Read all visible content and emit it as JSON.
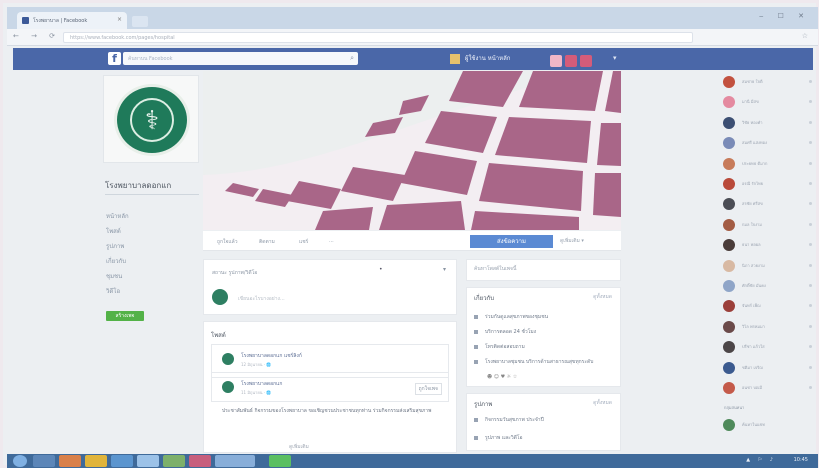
{
  "browser": {
    "tab_title": "โรงพยาบาล | Facebook",
    "tab_close": "×",
    "window_controls": "‒ ☐ ✕",
    "nav_buttons": "← → ⟳",
    "url": "https://www.facebook.com/pages/hospital",
    "bookmark_star": "☆"
  },
  "fb": {
    "logo": "f",
    "search_placeholder": "ค้นหาบน Facebook",
    "search_icon": "⌕",
    "user_label": "ผู้ใช้งาน   หน้าหลัก",
    "menu_glyph": "▾"
  },
  "page": {
    "name": "โรงพยาบาลดอกแก",
    "logo_symbol": "⚕",
    "nav": [
      "หน้าหลัก",
      "โพสต์",
      "รูปภาพ",
      "เกี่ยวกับ",
      "ชุมชน",
      "วิดีโอ"
    ],
    "green_button": "สร้างเพจ",
    "tabs": [
      "ถูกใจแล้ว",
      "ติดตาม",
      "แชร์",
      "..."
    ],
    "like_button": "ส่งข้อความ",
    "more_button": "ดูเพิ่มเติม ▾",
    "composer_tab": "สถานะ   รูปภาพ/วิดีโอ",
    "composer_dot": "•",
    "composer_caret": "▾",
    "composer_placeholder": "เขียนอะไรบางอย่าง...",
    "feed_heading": "โพสต์",
    "posts": [
      {
        "name": "โรงพยาบาลดอกแก แชร์ลิงก์",
        "meta": "12 มิถุนายน · 🌐",
        "button": ""
      },
      {
        "name": "โรงพยาบาลดอกแก",
        "meta": "11 มิถุนายน · 🌐",
        "button": "ถูกใจเพจ"
      }
    ],
    "post_text": "ประชาสัมพันธ์ กิจกรรมของโรงพยาบาล ขอเชิญชวนประชาชนทุกท่าน ร่วมกิจกรรมส่งเสริมสุขภาพ",
    "see_more": "ดูเพิ่มเติม"
  },
  "right_info": {
    "top_label": "ค้นหาโพสต์ในเพจนี้",
    "about_title": "เกี่ยวกับ",
    "about_link": "ดูทั้งหมด",
    "about_rows": [
      "ร่วมกันดูแลสุขภาพของชุมชน",
      "บริการตลอด 24 ชั่วโมง",
      "โทรติดต่อสอบถาม",
      "โรงพยาบาลชุมชน บริการด้านสาธารณสุขทุกระดับ"
    ],
    "emoji_row": "☻ ☺ ♥ ☼ ☆",
    "photos_title": "รูปภาพ",
    "photos_link": "ดูทั้งหมด",
    "photo_rows": [
      "กิจกรรมวันสุขภาพ ประจำปี",
      "รูปภาพ และวิดีโอ"
    ]
  },
  "chat": {
    "friends": [
      {
        "name": "สมชาย ใจดี",
        "color": "#c2513f"
      },
      {
        "name": "มานี มีสุข",
        "color": "#e48aa0"
      },
      {
        "name": "วิชัย ทองคำ",
        "color": "#3c4f73"
      },
      {
        "name": "สมศรี แสงทอง",
        "color": "#7a8bb7"
      },
      {
        "name": "ประยุทธ ดีมาก",
        "color": "#c77b5a"
      },
      {
        "name": "อรุณี รักไทย",
        "color": "#b94a3a"
      },
      {
        "name": "สุรชัย ศรีสุข",
        "color": "#4b4d55"
      },
      {
        "name": "กมล ใจงาม",
        "color": "#a35c44"
      },
      {
        "name": "ธนา พูลผล",
        "color": "#4a3c3a"
      },
      {
        "name": "นิภา สวยงาม",
        "color": "#d8b9a3"
      },
      {
        "name": "ศักดิ์ชัย มั่นคง",
        "color": "#8fa5c8"
      },
      {
        "name": "จันทร์ เพ็ญ",
        "color": "#9b3f3a"
      },
      {
        "name": "วิไล พรหมมา",
        "color": "#6b4a4a"
      },
      {
        "name": "ปรีชา แก้วใส",
        "color": "#4c4648"
      },
      {
        "name": "ชุติมา เจริญ",
        "color": "#3b5a8f"
      },
      {
        "name": "อนุชา บุญมี",
        "color": "#c45a4a"
      }
    ],
    "groups_heading": "กลุ่มสนทนา",
    "search_name": "ค้นหาในแชท",
    "search_color": "#4f8a5b"
  },
  "taskbar": {
    "tray": "▲ ⚐ ♪",
    "clock": "10:45"
  }
}
